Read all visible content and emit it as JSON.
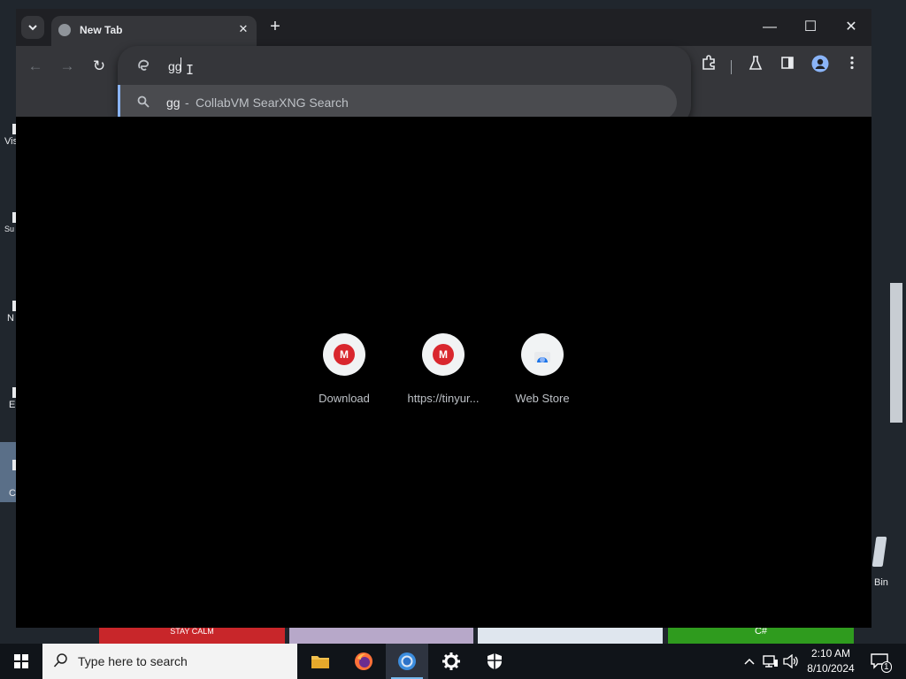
{
  "browser": {
    "tab": {
      "title": "New Tab",
      "close_glyph": "✕"
    },
    "new_tab_glyph": "+",
    "window_controls": {
      "minimize": "—",
      "maximize": "☐",
      "close": "✕"
    },
    "nav": {
      "back": "←",
      "forward": "→",
      "reload": "↻"
    },
    "omnibox": {
      "value": "gg",
      "suggestion": {
        "query": "gg",
        "separator": "-",
        "engine": "CollabVM SearXNG Search"
      }
    },
    "shortcuts": [
      {
        "label": "Download",
        "icon": "mega-icon"
      },
      {
        "label": "https://tinyur...",
        "icon": "mega-icon"
      },
      {
        "label": "Web Store",
        "icon": "web-store-icon"
      }
    ]
  },
  "desktop": {
    "icon_labels": [
      "Vis",
      "Su",
      "N",
      "E",
      "C"
    ],
    "recycle_bin_label": "Bin",
    "thumbnail_texts": [
      "STAY CALM",
      "C#"
    ]
  },
  "taskbar": {
    "search_placeholder": "Type here to search",
    "clock": {
      "time": "2:10 AM",
      "date": "8/10/2024"
    },
    "notification_count": "1"
  },
  "colors": {
    "accent": "#8ab4f8",
    "mega_red": "#d9272e",
    "toolbar": "#35363a"
  }
}
